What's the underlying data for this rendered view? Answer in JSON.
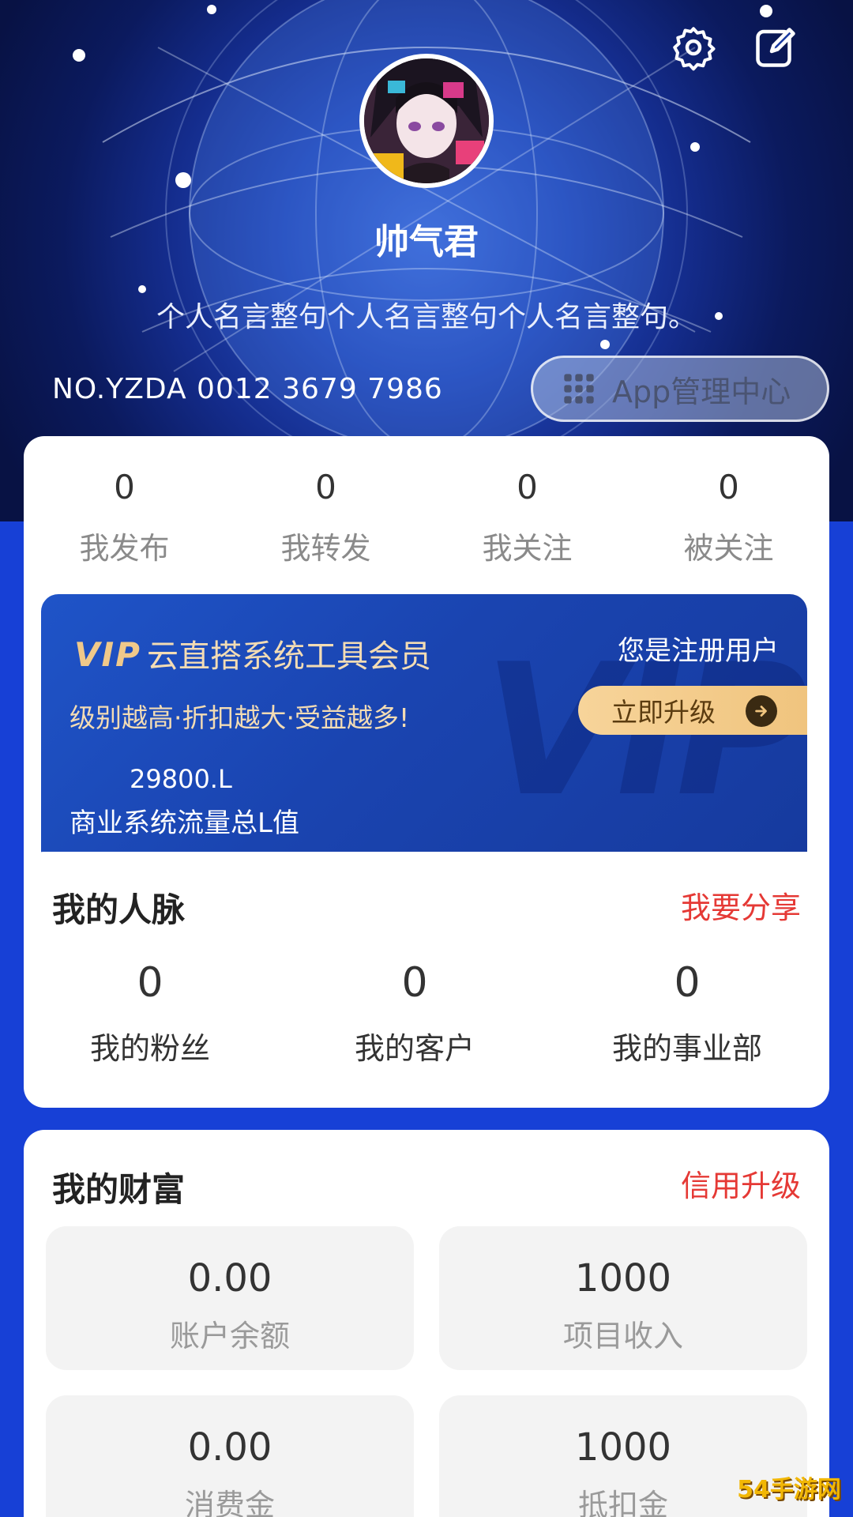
{
  "header": {
    "username": "帅气君",
    "motto": "个人名言整句个人名言整句个人名言整句。",
    "user_no": "NO.YZDA 0012 3679 7986",
    "app_center_label": "App管理中心",
    "icons": [
      "settings-icon",
      "edit-icon",
      "grid-icon"
    ]
  },
  "stats": [
    {
      "value": "0",
      "label": "我发布"
    },
    {
      "value": "0",
      "label": "我转发"
    },
    {
      "value": "0",
      "label": "我关注"
    },
    {
      "value": "0",
      "label": "被关注"
    }
  ],
  "vip": {
    "logo": "VIP",
    "title": "云直搭系统工具会员",
    "user_status": "您是注册用户",
    "subtitle": "级别越高·折扣越大·受益越多!",
    "upgrade_label": "立即升级",
    "value": "29800.L",
    "value_label": "商业系统流量总L值",
    "watermark": "VIP"
  },
  "network": {
    "title": "我的人脉",
    "link": "我要分享",
    "items": [
      {
        "value": "0",
        "label": "我的粉丝"
      },
      {
        "value": "0",
        "label": "我的客户"
      },
      {
        "value": "0",
        "label": "我的事业部"
      }
    ]
  },
  "wealth": {
    "title": "我的财富",
    "link": "信用升级",
    "items": [
      {
        "value": "0.00",
        "label": "账户余额"
      },
      {
        "value": "1000",
        "label": "项目收入"
      },
      {
        "value": "0.00",
        "label": "消费金"
      },
      {
        "value": "1000",
        "label": "抵扣金"
      }
    ]
  },
  "site_logo": "54手游网",
  "colors": {
    "background": "#1740d6",
    "accent_red": "#e53935",
    "vip_gold": "#f0c47e"
  }
}
